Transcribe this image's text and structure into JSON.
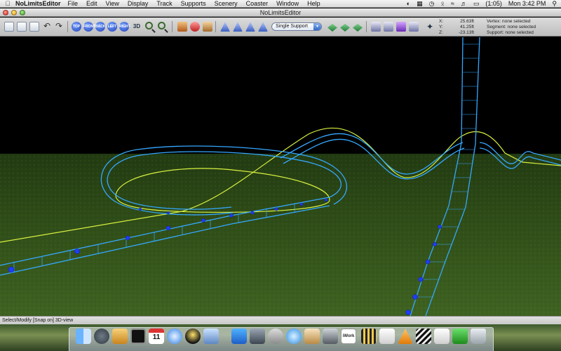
{
  "menubar": {
    "app_name": "NoLimitsEditor",
    "items": [
      "File",
      "Edit",
      "View",
      "Display",
      "Track",
      "Supports",
      "Scenery",
      "Coaster",
      "Window",
      "Help"
    ],
    "battery": "(1:05)",
    "clock": "Mon 3:42 PM"
  },
  "window": {
    "title": "NoLimitsEditor"
  },
  "toolbar": {
    "view_buttons": [
      "TOP",
      "FRONT",
      "BACK",
      "LEFT",
      "RIGHT"
    ],
    "view_3d": "3D",
    "support_type": "Single Support"
  },
  "coords": {
    "x_label": "X:",
    "x_value": "25.63ft",
    "vertex": "Vertex: none selected",
    "y_label": "Y:",
    "y_value": "41.25ft",
    "segment": "Segment: none selected",
    "z_label": "Z:",
    "z_value": "-23.13ft",
    "support": "Support: none selected"
  },
  "statusbar": {
    "text": "Select/Modify [Snap on] 3D-view"
  },
  "dock": {
    "calendar_day": "11",
    "iwork_label": "iWork"
  }
}
